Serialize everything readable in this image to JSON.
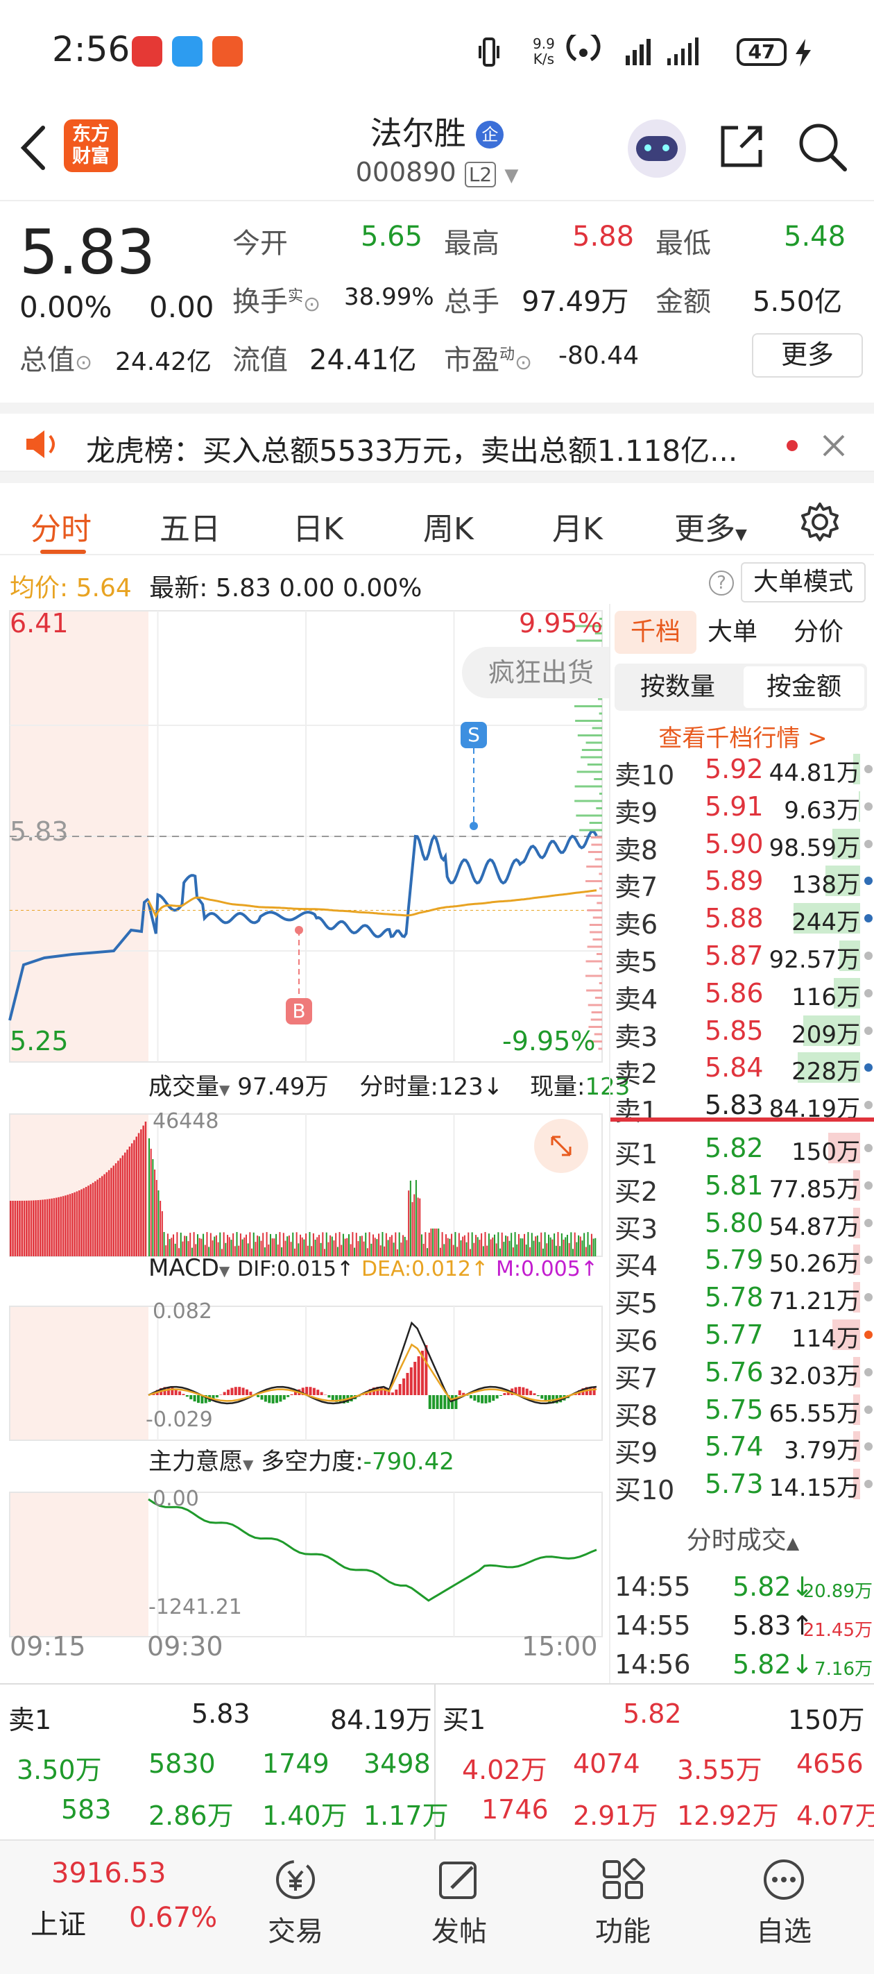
{
  "status_bar": {
    "time": "2:56",
    "net_speed": "9.9\nK/s",
    "battery": "47"
  },
  "header": {
    "logo_text": "东方\n财富",
    "stock_name": "法尔胜",
    "badge": "企",
    "stock_code": "000890",
    "level_badge": "L2"
  },
  "quote": {
    "price": "5.83",
    "change_pct": "0.00%",
    "change": "0.00",
    "open_label": "今开",
    "open": "5.65",
    "high_label": "最高",
    "high": "5.88",
    "low_label": "最低",
    "low": "5.48",
    "turnover_label": "换手",
    "turnover_sup": "实",
    "turnover": "38.99%",
    "volume_label": "总手",
    "volume": "97.49万",
    "amount_label": "金额",
    "amount": "5.50亿",
    "mktcap_label": "总值",
    "mktcap": "24.42亿",
    "float_label": "流值",
    "float": "24.41亿",
    "pe_label": "市盈",
    "pe_sup": "动",
    "pe": "-80.44",
    "more_button": "更多"
  },
  "notice": {
    "text": "龙虎榜：买入总额5533万元，卖出总额1.118亿..."
  },
  "tabs": [
    "分时",
    "五日",
    "日K",
    "周K",
    "月K",
    "更多"
  ],
  "avg_bar": {
    "avg_label": "均价:",
    "avg": "5.64",
    "latest_label": "最新:",
    "latest": "5.83",
    "chg": "0.00",
    "pct": "0.00%",
    "mode_button": "大单模式"
  },
  "chart": {
    "price_top": "6.41",
    "price_bottom": "5.25",
    "price_ref": "5.83",
    "pct_top": "9.95%",
    "pct_bottom": "-9.95%",
    "event_tag": "疯狂出货",
    "sell_marker": "S",
    "buy_marker": "B",
    "vol_label": "成交量",
    "vol_total": "97.49万",
    "vol_bar_label": "分时量:123↓",
    "vol_now_label": "现量:",
    "vol_now": "123",
    "vol_max": "46448",
    "macd_label": "MACD",
    "dif": "DIF:0.015↑",
    "dea": "DEA:0.012↑",
    "m": "M:0.005↑",
    "macd_top": "0.082",
    "macd_bottom": "-0.029",
    "main_label": "主力意愿",
    "power_label": "多空力度:",
    "power": "-790.42",
    "main_top": "0.00",
    "main_bottom": "-1241.21",
    "time_start": "09:15",
    "time_open": "09:30",
    "time_end": "15:00"
  },
  "book": {
    "tabs": [
      "千档",
      "大单",
      "分价"
    ],
    "sort_tabs": [
      "按数量",
      "按金额"
    ],
    "link": "查看千档行情 >",
    "sells": [
      {
        "label": "卖10",
        "price": "5.92",
        "vol": "44.81万"
      },
      {
        "label": "卖9",
        "price": "5.91",
        "vol": "9.63万"
      },
      {
        "label": "卖8",
        "price": "5.90",
        "vol": "98.59万"
      },
      {
        "label": "卖7",
        "price": "5.89",
        "vol": "138万"
      },
      {
        "label": "卖6",
        "price": "5.88",
        "vol": "244万"
      },
      {
        "label": "卖5",
        "price": "5.87",
        "vol": "92.57万"
      },
      {
        "label": "卖4",
        "price": "5.86",
        "vol": "116万"
      },
      {
        "label": "卖3",
        "price": "5.85",
        "vol": "209万"
      },
      {
        "label": "卖2",
        "price": "5.84",
        "vol": "228万"
      },
      {
        "label": "卖1",
        "price": "5.83",
        "vol": "84.19万"
      }
    ],
    "buys": [
      {
        "label": "买1",
        "price": "5.82",
        "vol": "150万"
      },
      {
        "label": "买2",
        "price": "5.81",
        "vol": "77.85万"
      },
      {
        "label": "买3",
        "price": "5.80",
        "vol": "54.87万"
      },
      {
        "label": "买4",
        "price": "5.79",
        "vol": "50.26万"
      },
      {
        "label": "买5",
        "price": "5.78",
        "vol": "71.21万"
      },
      {
        "label": "买6",
        "price": "5.77",
        "vol": "114万"
      },
      {
        "label": "买7",
        "price": "5.76",
        "vol": "32.03万"
      },
      {
        "label": "买8",
        "price": "5.75",
        "vol": "65.55万"
      },
      {
        "label": "买9",
        "price": "5.74",
        "vol": "3.79万"
      },
      {
        "label": "买10",
        "price": "5.73",
        "vol": "14.15万"
      }
    ],
    "trades_title": "分时成交",
    "trades": [
      {
        "time": "14:55",
        "price": "5.82↓",
        "vol": "20.89万"
      },
      {
        "time": "14:55",
        "price": "5.83↑",
        "vol": "21.45万"
      },
      {
        "time": "14:56",
        "price": "5.82↓",
        "vol": "7.16万"
      }
    ]
  },
  "depth": {
    "sell_label": "卖1",
    "sell_price": "5.83",
    "sell_vol": "84.19万",
    "buy_label": "买1",
    "buy_price": "5.82",
    "buy_vol": "150万",
    "sell_row1": [
      "3.50万",
      "5830",
      "1749",
      "3498"
    ],
    "sell_row2": [
      "583",
      "2.86万",
      "1.40万",
      "1.17万"
    ],
    "buy_row1": [
      "4.02万",
      "4074",
      "3.55万",
      "4656"
    ],
    "buy_row2": [
      "1746",
      "2.91万",
      "12.92万",
      "4.07万"
    ]
  },
  "nav": {
    "index_value": "3916.53",
    "index_name": "上证",
    "index_pct": "0.67%",
    "items": [
      "交易",
      "发帖",
      "功能",
      "自选"
    ]
  },
  "colors": {
    "up": "#e0333c",
    "down": "#1f9a2b",
    "brand": "#f25a1e",
    "avg": "#e8a322",
    "price_line": "#2f6db5"
  }
}
